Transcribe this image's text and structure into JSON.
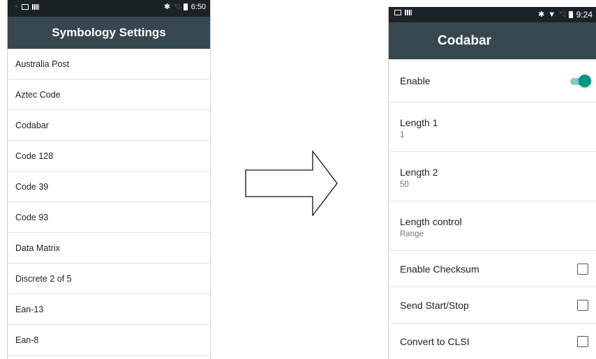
{
  "left_screen": {
    "status_bar": {
      "left_icons": [
        "wifi-icon",
        "image-icon",
        "signal-bars-icon"
      ],
      "right_icons": [
        "bluetooth-icon",
        "no-signal-icon",
        "battery-icon"
      ],
      "time": "6:50"
    },
    "title": "Symbology Settings",
    "items": [
      {
        "label": "Australia Post"
      },
      {
        "label": "Aztec Code"
      },
      {
        "label": "Codabar"
      },
      {
        "label": "Code 128"
      },
      {
        "label": "Code 39"
      },
      {
        "label": "Code 93"
      },
      {
        "label": "Data Matrix"
      },
      {
        "label": "Discrete 2 of 5"
      },
      {
        "label": "Ean-13"
      },
      {
        "label": "Ean-8"
      }
    ]
  },
  "arrow": {
    "icon": "right-arrow-icon"
  },
  "right_screen": {
    "status_bar": {
      "left_icons": [
        "image-icon",
        "signal-bars-icon"
      ],
      "right_icons": [
        "bluetooth-icon",
        "wifi-icon",
        "no-signal-icon",
        "battery-icon"
      ],
      "time": "9:24"
    },
    "title": "Codabar",
    "settings": {
      "enable": {
        "label": "Enable",
        "on": true
      },
      "length1": {
        "label": "Length 1",
        "value": "1"
      },
      "length2": {
        "label": "Length 2",
        "value": "50"
      },
      "length_control": {
        "label": "Length control",
        "value": "Range"
      },
      "enable_checksum": {
        "label": "Enable Checksum",
        "checked": false
      },
      "send_start_stop": {
        "label": "Send Start/Stop",
        "checked": false
      },
      "convert_clsi": {
        "label": "Convert to CLSI",
        "checked": false
      }
    },
    "accent_color": "#009688"
  }
}
